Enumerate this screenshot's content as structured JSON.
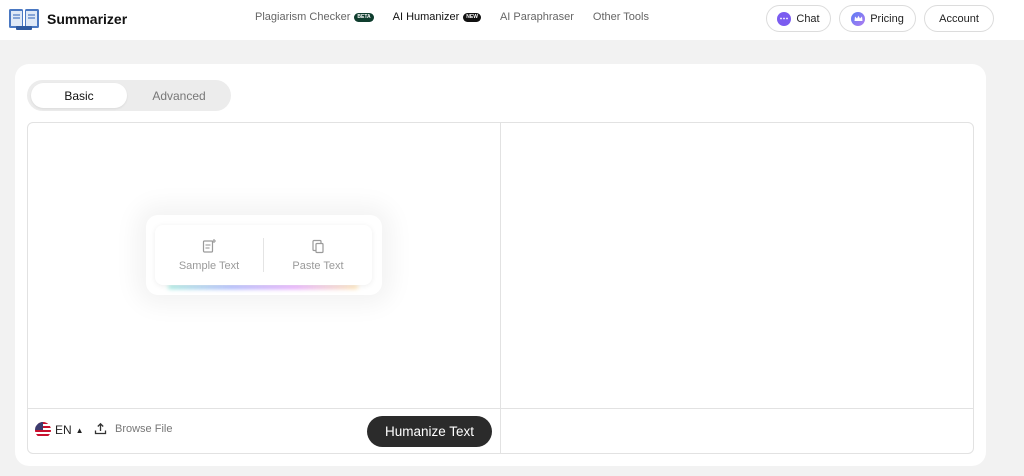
{
  "header": {
    "brand": "Summarizer",
    "nav": [
      {
        "label": "Plagiarism Checker",
        "tag": "BETA"
      },
      {
        "label": "AI Humanizer",
        "tag": "NEW"
      },
      {
        "label": "AI Paraphraser"
      },
      {
        "label": "Other Tools"
      }
    ],
    "chat_label": "Chat",
    "pricing_label": "Pricing",
    "account_label": "Account"
  },
  "modes": {
    "basic": "Basic",
    "advanced": "Advanced",
    "selected": "Basic"
  },
  "editor": {
    "sample_label": "Sample Text",
    "paste_label": "Paste Text",
    "language": "EN",
    "browse_label": "Browse File",
    "submit_label": "Humanize Text"
  },
  "colors": {
    "accent": "#2b2b2b",
    "chat_icon": "#7b5cf0",
    "pricing_icon": "#5b7cf5"
  }
}
